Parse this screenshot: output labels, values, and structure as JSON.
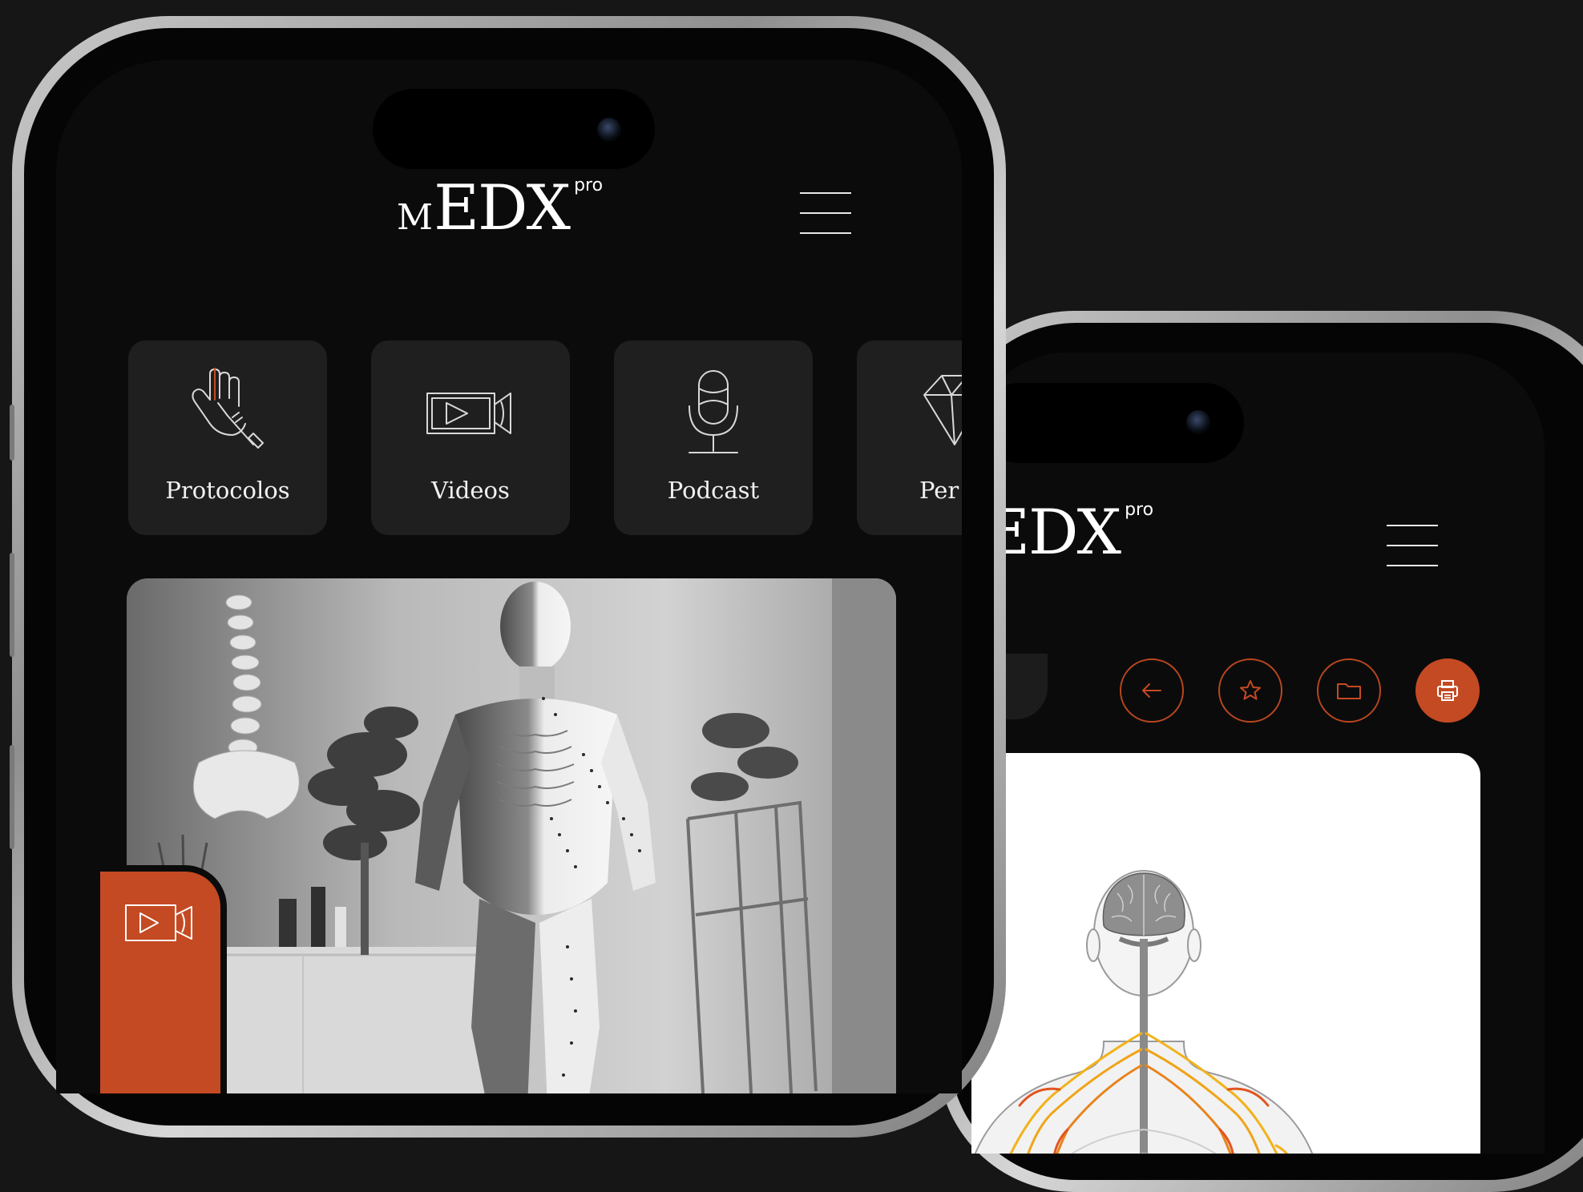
{
  "app": {
    "logo_m": "M",
    "logo_main": "EDX",
    "logo_pro": "pro"
  },
  "front_phone": {
    "categories": [
      {
        "label": "Protocolos",
        "icon": "hand-instrument-icon"
      },
      {
        "label": "Videos",
        "icon": "video-camera-icon"
      },
      {
        "label": "Podcast",
        "icon": "microphone-icon"
      },
      {
        "label": "Per",
        "icon": "gem-icon"
      }
    ],
    "hero_badge_icon": "video-camera-icon"
  },
  "back_phone": {
    "actions": [
      {
        "icon": "arrow-left-icon",
        "active": false
      },
      {
        "icon": "star-icon",
        "active": false
      },
      {
        "icon": "folder-icon",
        "active": false
      },
      {
        "icon": "printer-icon",
        "active": true
      }
    ]
  },
  "colors": {
    "background": "#161616",
    "accent": "#c44a23",
    "tile": "#1f1f1f",
    "screen": "#0b0b0b"
  }
}
